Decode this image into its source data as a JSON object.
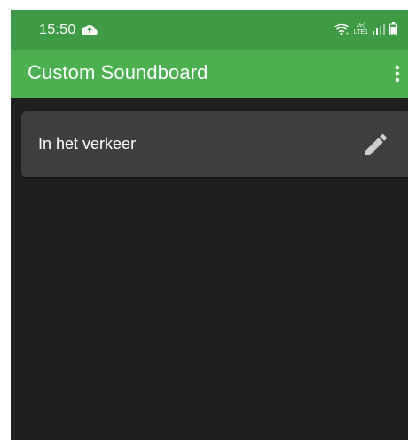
{
  "status_bar": {
    "time": "15:50",
    "cloud_icon": "cloud-upload-icon",
    "network_top": "Vo)",
    "network_bottom": "LTE1",
    "icons": [
      "wifi-icon",
      "signal-icon",
      "battery-icon"
    ]
  },
  "app_bar": {
    "title": "Custom Soundboard",
    "menu_icon": "more-vert-icon"
  },
  "list": {
    "items": [
      {
        "label": "In het verkeer",
        "action_icon": "edit-pencil-icon"
      }
    ]
  },
  "colors": {
    "status_bar": "#3f9a45",
    "app_bar": "#4caf50",
    "background": "#1f1f1f",
    "card": "#3f3f3f",
    "text": "#ffffff",
    "icon_gray": "#cfcfcf"
  }
}
